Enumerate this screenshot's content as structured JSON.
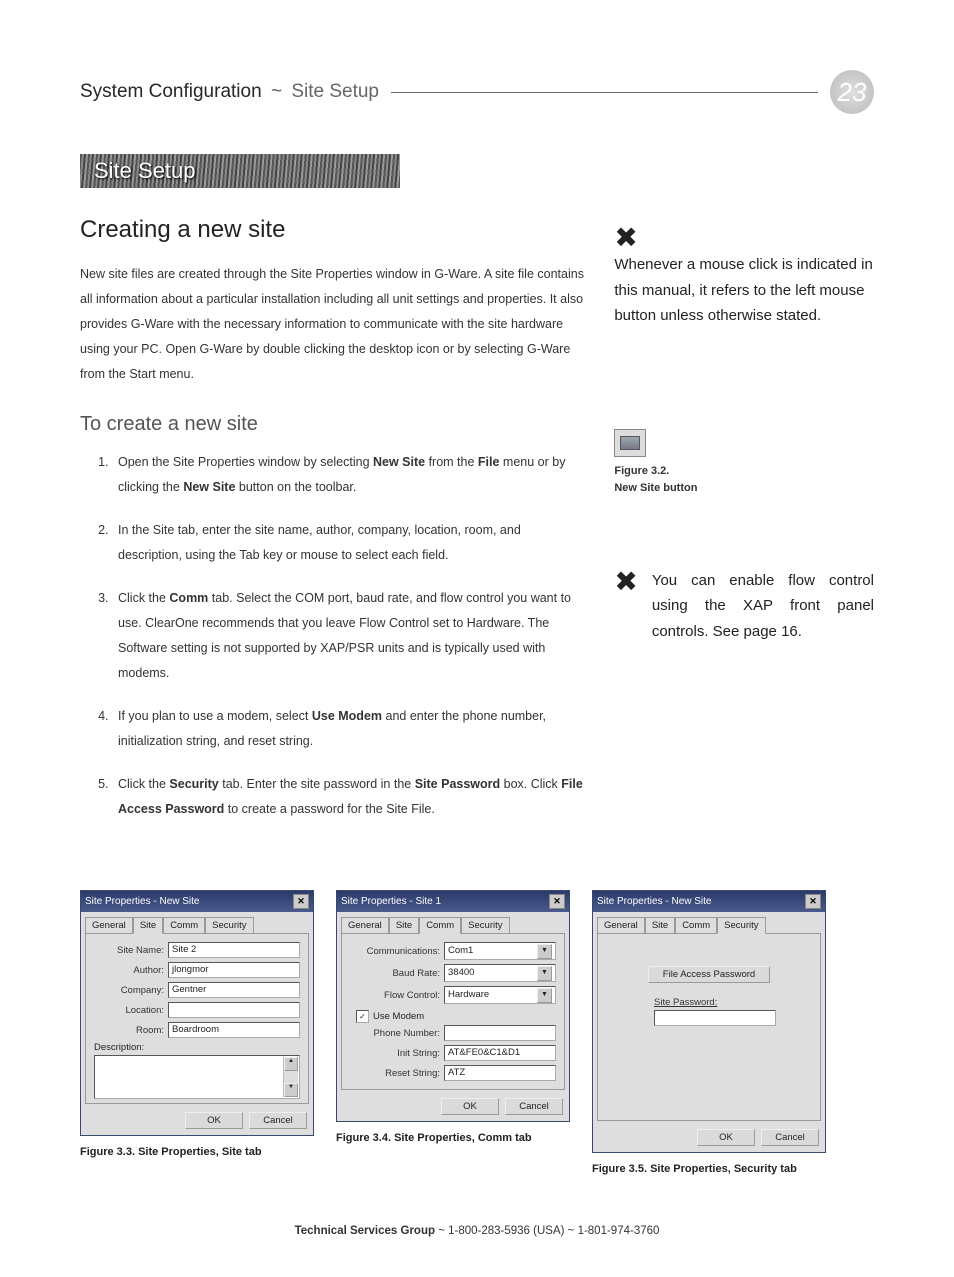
{
  "header": {
    "breadcrumb1": "System Configuration",
    "tilde": "~",
    "breadcrumb2": "Site Setup",
    "page_number": "23"
  },
  "banner": "Site Setup",
  "heading": "Creating a new site",
  "intro": "New site files are created through the Site Properties window in G-Ware. A site file contains all information about a particular installation including all unit settings and properties. It also provides G-Ware with the necessary information to communicate with the site hardware using your PC. Open G-Ware by double clicking the desktop icon or by selecting G-Ware from the Start menu.",
  "subheading": "To create a new site",
  "steps": {
    "s1a": "Open the Site Properties window by selecting ",
    "s1b": "New Site",
    "s1c": " from the ",
    "s1d": "File",
    "s1e": " menu or by clicking the ",
    "s1f": "New Site",
    "s1g": " button on the toolbar.",
    "s2": "In the Site tab, enter the site name, author, company, location, room, and description, using the Tab key or mouse to select each field.",
    "s3a": "Click the ",
    "s3b": "Comm",
    "s3c": " tab. Select the COM port, baud rate, and flow control you want to use. ClearOne recommends that you leave Flow Control set to Hardware. The Software setting is not supported by XAP/PSR units and is typically used with modems.",
    "s4a": "If you plan to use a modem, select ",
    "s4b": "Use Modem",
    "s4c": " and enter the phone number, initialization string, and reset string.",
    "s5a": "Click the ",
    "s5b": "Security",
    "s5c": " tab. Enter the site password in the ",
    "s5d": "Site Password",
    "s5e": " box. Click ",
    "s5f": "File Access Password",
    "s5g": " to create a password for the Site File."
  },
  "sidenotes": {
    "note1": "Whenever a mouse click is indicated in this manual, it refers to the left mouse button unless otherwise stated.",
    "fig32a": "Figure 3.2.",
    "fig32b": "New Site button",
    "note2": "You can enable flow control using the XAP front panel controls. See page 16."
  },
  "dialogs": {
    "d1": {
      "title": "Site Properties - New Site",
      "tabs": [
        "General",
        "Site",
        "Comm",
        "Security"
      ],
      "fields": {
        "site_name_l": "Site Name:",
        "site_name_v": "Site 2",
        "author_l": "Author:",
        "author_v": "jlongmor",
        "company_l": "Company:",
        "company_v": "Gentner",
        "location_l": "Location:",
        "location_v": "",
        "room_l": "Room:",
        "room_v": "Boardroom",
        "desc_l": "Description:"
      },
      "ok": "OK",
      "cancel": "Cancel",
      "caption": "Figure 3.3. Site Properties, Site tab"
    },
    "d2": {
      "title": "Site Properties - Site 1",
      "tabs": [
        "General",
        "Site",
        "Comm",
        "Security"
      ],
      "fields": {
        "comm_l": "Communications:",
        "comm_v": "Com1",
        "baud_l": "Baud Rate:",
        "baud_v": "38400",
        "flow_l": "Flow Control:",
        "flow_v": "Hardware",
        "use_modem": "Use Modem",
        "phone_l": "Phone Number:",
        "phone_v": "",
        "init_l": "Init String:",
        "init_v": "AT&FE0&C1&D1",
        "reset_l": "Reset String:",
        "reset_v": "ATZ"
      },
      "ok": "OK",
      "cancel": "Cancel",
      "caption": "Figure 3.4. Site Properties, Comm tab"
    },
    "d3": {
      "title": "Site Properties - New Site",
      "tabs": [
        "General",
        "Site",
        "Comm",
        "Security"
      ],
      "file_access": "File Access Password",
      "site_pw_l": "Site Password:",
      "ok": "OK",
      "cancel": "Cancel",
      "caption": "Figure 3.5. Site Properties, Security tab"
    }
  },
  "footer": {
    "group": "Technical Services Group",
    "tilde": " ~ ",
    "phone1": "1-800-283-5936 (USA)",
    "phone2": "1-801-974-3760"
  }
}
